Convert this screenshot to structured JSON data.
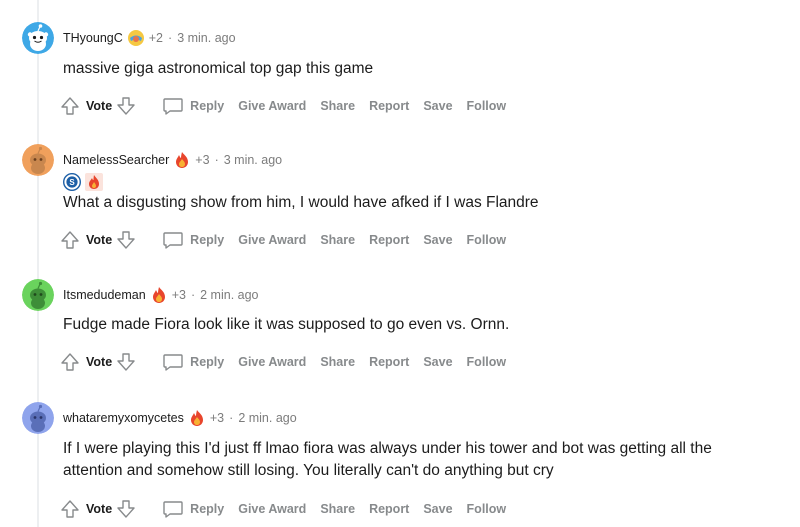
{
  "comments": [
    {
      "username": "THyoungC",
      "award_count": "+2",
      "time": "3 min. ago",
      "avatar_color": "#3ea8e6",
      "text": "massive giga astronomical top gap this game",
      "award_icon": "wholesome-award-icon",
      "flairs": []
    },
    {
      "username": "NamelessSearcher",
      "award_count": "+3",
      "time": "3 min. ago",
      "avatar_color": "#f0a05c",
      "text": "What a disgusting show from him, I would have afked if I was Flandre",
      "award_icon": "fire-award-icon",
      "flairs": [
        "schalke-logo-icon",
        "flame-flair-icon"
      ]
    },
    {
      "username": "Itsmedudeman",
      "award_count": "+3",
      "time": "2 min. ago",
      "avatar_color": "#6ad35d",
      "text": "Fudge made Fiora look like it was supposed to go even vs. Ornn.",
      "award_icon": "fire-award-icon",
      "flairs": []
    },
    {
      "username": "whataremyxomycetes",
      "award_count": "+3",
      "time": "2 min. ago",
      "avatar_color": "#8fa4ec",
      "text": "If I were playing this I'd just ff lmao fiora was always under his tower and bot was getting all the attention and somehow still losing. You literally can't do anything but cry",
      "award_icon": "fire-award-icon",
      "flairs": []
    }
  ],
  "actions": {
    "vote": "Vote",
    "reply": "Reply",
    "give_award": "Give Award",
    "share": "Share",
    "report": "Report",
    "save": "Save",
    "follow": "Follow"
  },
  "colors": {
    "meta_gray": "#7c7c7c",
    "action_gray": "#878a8c",
    "text": "#1c1c1c",
    "thread_line": "#edeff1"
  }
}
